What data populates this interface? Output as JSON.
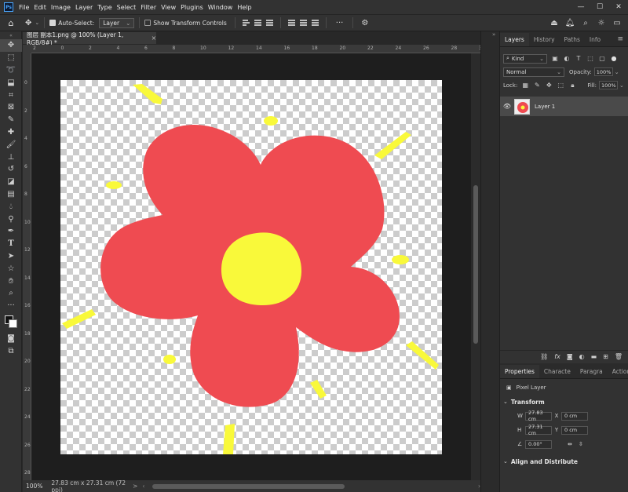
{
  "app": {
    "logo_text": "Ps"
  },
  "menu": [
    "File",
    "Edit",
    "Image",
    "Layer",
    "Type",
    "Select",
    "Filter",
    "View",
    "Plugins",
    "Window",
    "Help"
  ],
  "window_controls": {
    "minimize": "—",
    "maximize": "☐",
    "close": "✕"
  },
  "options_bar": {
    "auto_select_label": "Auto-Select:",
    "auto_select_value": "Layer",
    "show_transform_label": "Show Transform Controls",
    "more_label": "···"
  },
  "document_tab": {
    "title": "图层 副本1.png @ 100% (Layer 1, RGB/8#) *",
    "close": "×"
  },
  "rulers": {
    "h_ticks": [
      "2",
      "0",
      "2",
      "4",
      "6",
      "8",
      "10",
      "12",
      "14",
      "16",
      "18",
      "20",
      "22",
      "24",
      "26",
      "28",
      "30"
    ],
    "v_ticks": [
      "0",
      "2",
      "4",
      "6",
      "8",
      "10",
      "12",
      "14",
      "16",
      "18",
      "20",
      "22",
      "24",
      "26",
      "28"
    ]
  },
  "status_bar": {
    "zoom": "100%",
    "dimensions": "27.83 cm x 27.31 cm (72 ppi)",
    "caret": ">"
  },
  "layers_panel": {
    "tabs": [
      "Layers",
      "History",
      "Paths",
      "Info"
    ],
    "kind_label": "Kind",
    "blend_mode": "Normal",
    "opacity_label": "Opacity:",
    "opacity_value": "100%",
    "lock_label": "Lock:",
    "fill_label": "Fill:",
    "fill_value": "100%",
    "layers": [
      {
        "name": "Layer 1",
        "visible": true
      }
    ],
    "footer_icons": [
      "link-icon",
      "fx-icon",
      "mask-icon",
      "adjustment-icon",
      "group-icon",
      "new-layer-icon",
      "delete-icon"
    ]
  },
  "properties_panel": {
    "tabs": [
      "Properties",
      "Characte",
      "Paragra",
      "Actions"
    ],
    "layer_type": "Pixel Layer",
    "transform_title": "Transform",
    "w_label": "W",
    "w_value": "27.83 cm",
    "h_label": "H",
    "h_value": "27.31 cm",
    "x_label": "X",
    "x_value": "0 cm",
    "y_label": "Y",
    "y_value": "0 cm",
    "angle_value": "0.00°",
    "align_title": "Align and Distribute"
  },
  "colors": {
    "petal": "#ef4b51",
    "center": "#f9f93a",
    "accent": "#4aa7ff"
  }
}
